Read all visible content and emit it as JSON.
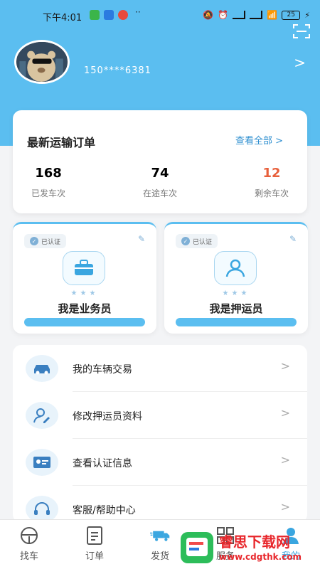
{
  "status": {
    "time": "下午4:01",
    "battery": "25"
  },
  "profile": {
    "phone": "150****6381"
  },
  "orders": {
    "title": "最新运输订单",
    "view_all": "查看全部 >",
    "stats": [
      {
        "value": "168",
        "label": "已发车次",
        "color": "#222222"
      },
      {
        "value": "74",
        "label": "在途车次",
        "color": "#222222"
      },
      {
        "value": "12",
        "label": "剩余车次",
        "color": "#e8603c"
      }
    ]
  },
  "roles": [
    {
      "badge": "已认证",
      "label": "我是业务员",
      "icon": "briefcase-icon"
    },
    {
      "badge": "已认证",
      "label": "我是押运员",
      "icon": "person-icon"
    }
  ],
  "menu": [
    {
      "label": "我的车辆交易",
      "icon": "car-icon"
    },
    {
      "label": "修改押运员资料",
      "icon": "user-edit-icon"
    },
    {
      "label": "查看认证信息",
      "icon": "id-card-icon"
    },
    {
      "label": "客服/帮助中心",
      "icon": "headset-icon"
    }
  ],
  "tabs": [
    {
      "label": "找车",
      "icon": "steering-wheel-icon"
    },
    {
      "label": "订单",
      "icon": "document-icon"
    },
    {
      "label": "发货",
      "icon": "truck-icon"
    },
    {
      "label": "服务",
      "icon": "grid-icon"
    },
    {
      "label": "我的",
      "icon": "profile-icon"
    }
  ],
  "watermark": {
    "title": "睿思下载网",
    "url": "www.cdgthk.com"
  },
  "colors": {
    "primary": "#5bbef0",
    "link": "#2f8fd0",
    "accent_red": "#e8603c"
  }
}
